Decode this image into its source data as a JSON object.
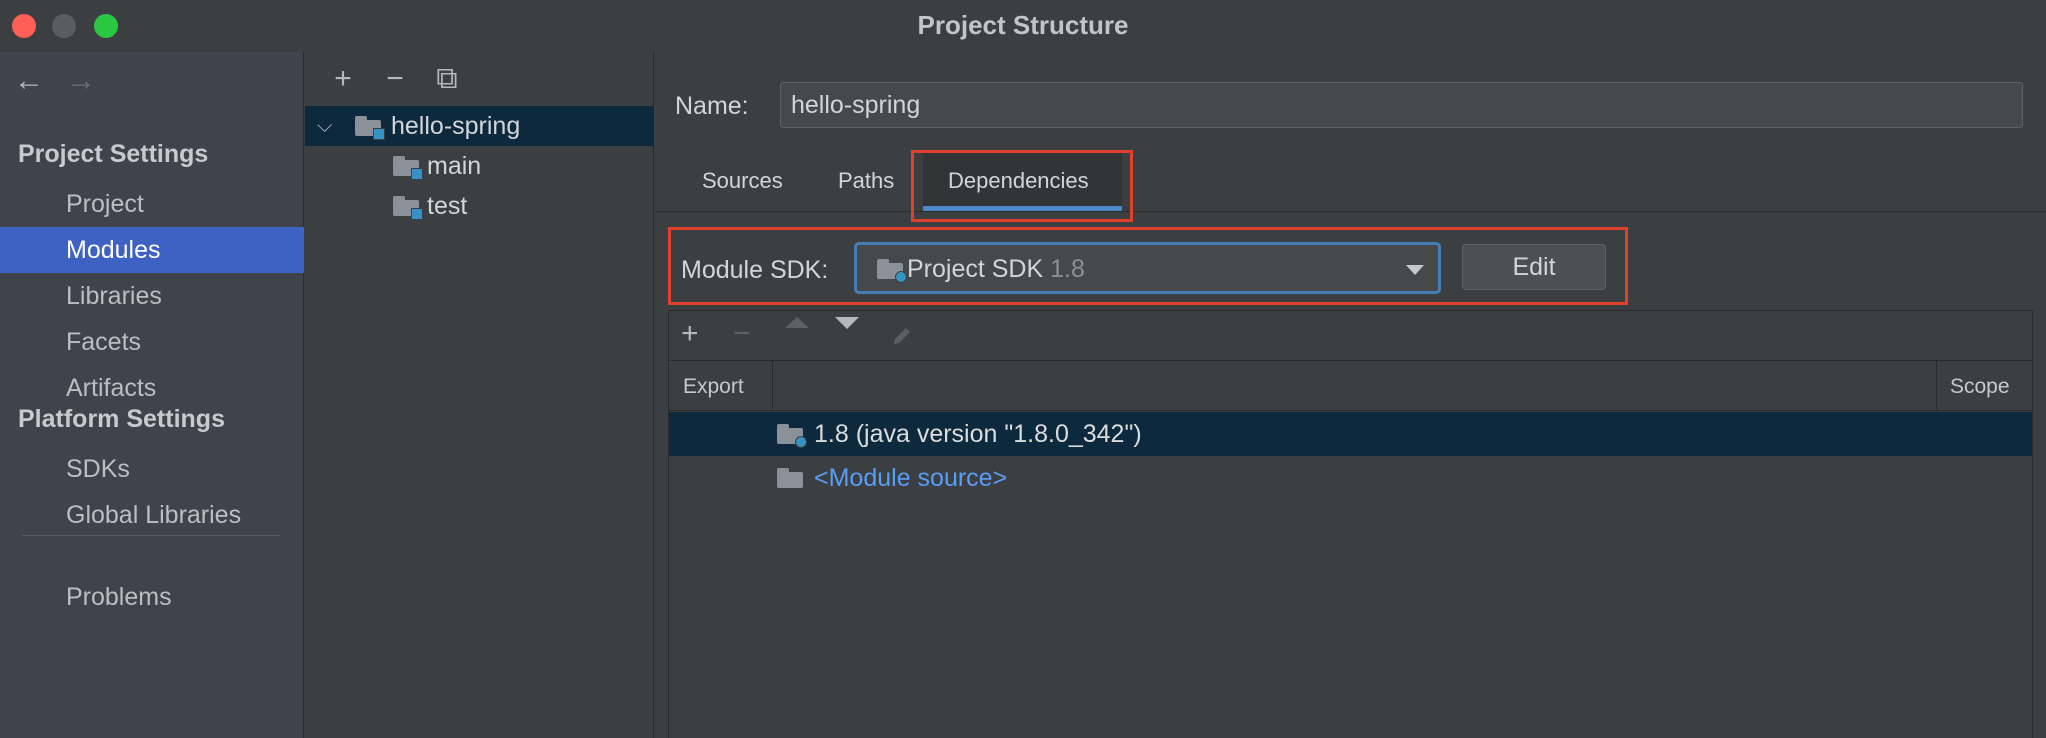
{
  "window": {
    "title": "Project Structure"
  },
  "sidebar": {
    "nav_back": "←",
    "nav_forward": "→",
    "project_settings_header": "Project Settings",
    "project_settings_items": [
      {
        "label": "Project",
        "selected": false
      },
      {
        "label": "Modules",
        "selected": true
      },
      {
        "label": "Libraries",
        "selected": false
      },
      {
        "label": "Facets",
        "selected": false
      },
      {
        "label": "Artifacts",
        "selected": false
      }
    ],
    "platform_settings_header": "Platform Settings",
    "platform_settings_items": [
      {
        "label": "SDKs"
      },
      {
        "label": "Global Libraries"
      }
    ],
    "problems_label": "Problems"
  },
  "module_tree": {
    "toolbar": {
      "add": "+",
      "remove": "−",
      "copy": "⧉"
    },
    "nodes": [
      {
        "label": "hello-spring",
        "expanded": true,
        "selected": true
      },
      {
        "label": "main"
      },
      {
        "label": "test"
      }
    ]
  },
  "module_details": {
    "name_label": "Name:",
    "name_value": "hello-spring",
    "tabs": [
      {
        "label": "Sources",
        "active": false
      },
      {
        "label": "Paths",
        "active": false
      },
      {
        "label": "Dependencies",
        "active": true
      }
    ],
    "sdk_label": "Module SDK:",
    "sdk_value": "Project SDK",
    "sdk_version": "1.8",
    "edit_label": "Edit",
    "dep_toolbar": {
      "add": "+",
      "remove": "−"
    },
    "columns": {
      "export": "Export",
      "scope": "Scope"
    },
    "dependencies": [
      {
        "label": "1.8 (java version \"1.8.0_342\")",
        "selected": true,
        "icon": "jdk-folder-icon"
      },
      {
        "label": "<Module source>",
        "selected": false,
        "icon": "source-folder-icon"
      }
    ]
  },
  "colors": {
    "accent": "#3d62c4",
    "selection": "#0d293e",
    "highlight_box": "#e0412a",
    "tab_underline": "#4a88c7",
    "link": "#589df6"
  }
}
